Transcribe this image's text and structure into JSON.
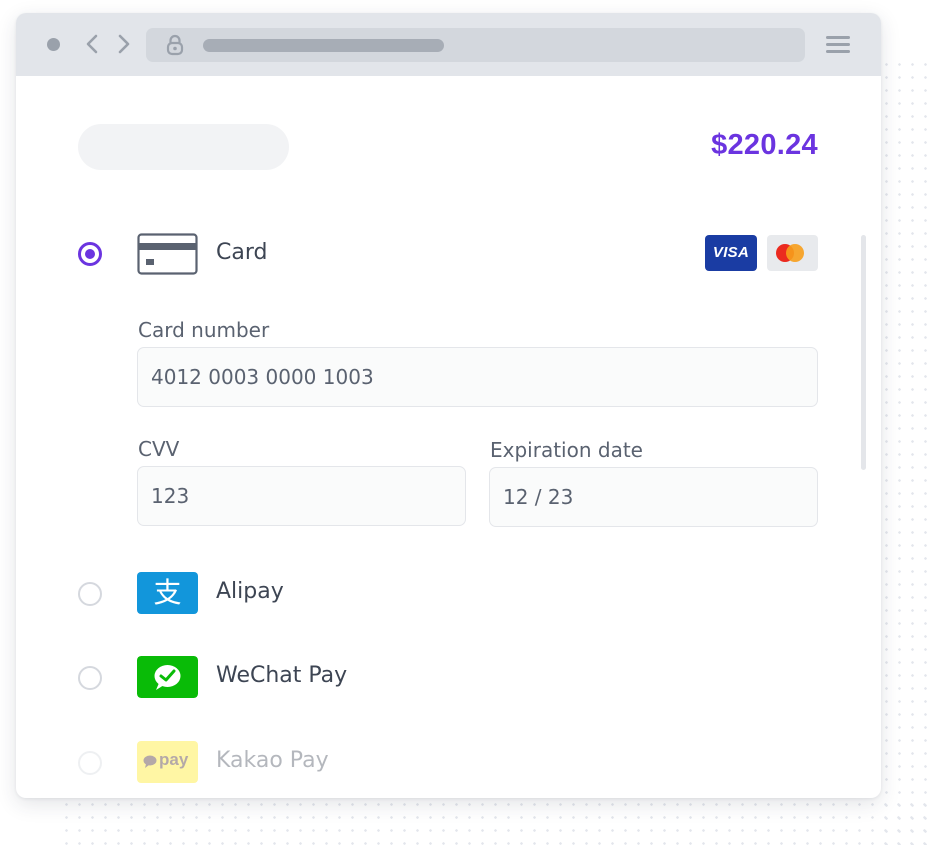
{
  "browser": {
    "icons": {
      "dot": "dot-icon",
      "back": "chevron-left-icon",
      "forward": "chevron-right-icon",
      "lock": "lock-icon",
      "menu": "hamburger-menu-icon"
    }
  },
  "checkout": {
    "amount": "$220.24",
    "accent_color": "#6b34e0"
  },
  "payment_methods": [
    {
      "label": "Card",
      "selected": true,
      "icon": "credit-card-icon"
    },
    {
      "label": "Alipay",
      "selected": false,
      "icon": "alipay-icon",
      "color": "#1296db"
    },
    {
      "label": "WeChat Pay",
      "selected": false,
      "icon": "wechat-pay-icon",
      "color": "#09bb07"
    },
    {
      "label": "Kakao Pay",
      "selected": false,
      "icon": "kakao-pay-icon",
      "color": "#ffe812"
    }
  ],
  "card_brands": [
    {
      "name": "VISA",
      "icon": "visa-icon",
      "color": "#1a3ca3"
    },
    {
      "name": "Mastercard",
      "icon": "mastercard-icon"
    }
  ],
  "card_form": {
    "card_number_label": "Card number",
    "card_number_value": "4012 0003 0000 1003",
    "cvv_label": "CVV",
    "cvv_value": "123",
    "expiration_label": "Expiration date",
    "expiration_value": "12 / 23"
  },
  "kakao_icon_text": "pay",
  "alipay_icon_glyph": "支"
}
